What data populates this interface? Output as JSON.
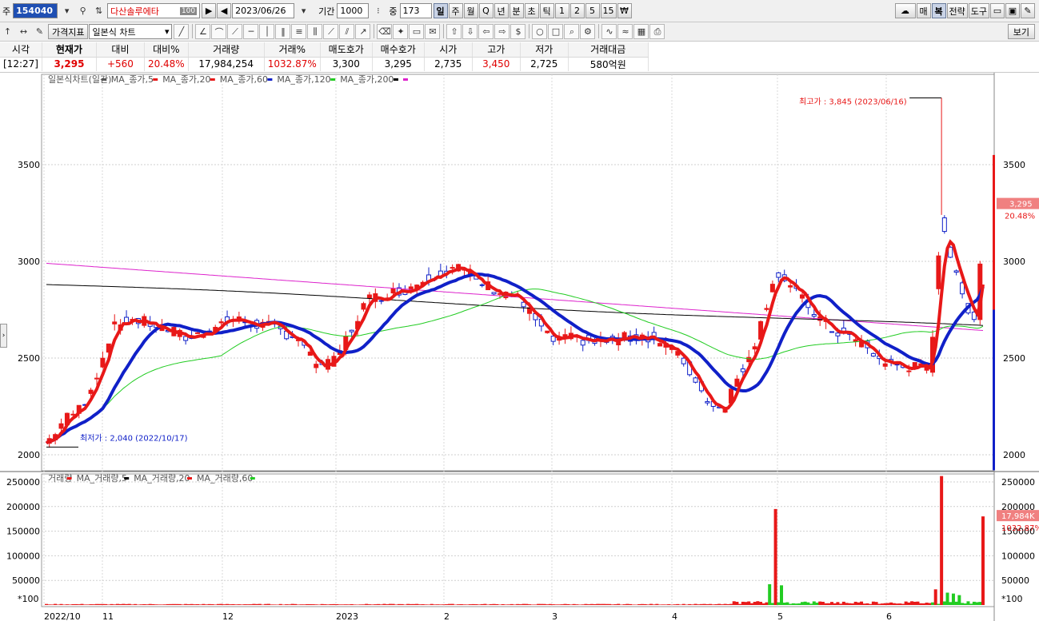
{
  "toolbar1": {
    "type_label": "주",
    "stock_code": "154040",
    "stock_name": "다산솔루에타",
    "name_badge": "100",
    "date": "2023/06/26",
    "period_label": "기간",
    "period_value": "1000",
    "count_label": "중",
    "count_value": "173",
    "intervals": [
      "일",
      "주",
      "월",
      "Q",
      "년",
      "분",
      "초",
      "틱",
      "1",
      "2",
      "5",
      "15"
    ],
    "active_interval": "일",
    "right_buttons": [
      "매",
      "복",
      "전략",
      "도구"
    ]
  },
  "toolbar2": {
    "price_indicator": "가격지표",
    "chart_type": "일본식 차트",
    "view_button": "보기"
  },
  "quote": {
    "headers": [
      "시각",
      "현재가",
      "대비",
      "대비%",
      "거래량",
      "거래%",
      "매도호가",
      "매수호가",
      "시가",
      "고가",
      "저가",
      "거래대금"
    ],
    "values": [
      "[12:27]",
      "3,295",
      "+560",
      "20.48%",
      "17,984,254",
      "1032.87%",
      "3,300",
      "3,295",
      "2,735",
      "3,450",
      "2,725",
      "580억원"
    ]
  },
  "price_panel": {
    "legend": [
      {
        "name": "일본식차트(일간)",
        "color": "#555555"
      },
      {
        "name": "MA_종가,5",
        "color": "#e81818"
      },
      {
        "name": "MA_종가,20",
        "color": "#e81818"
      },
      {
        "name": "MA_종가,60",
        "color": "#1020c8"
      },
      {
        "name": "MA_종가,120",
        "color": "#22cc22"
      },
      {
        "name": "MA_종가,200",
        "color": "#000000"
      },
      {
        "name": "",
        "color": "#dd22cc"
      }
    ],
    "y_ticks": [
      "3500",
      "3000",
      "2500",
      "2000"
    ],
    "high_annotation": "최고가 : 3,845 (2023/06/16)",
    "low_annotation": "최저가 : 2,040 (2022/10/17)",
    "current_price_label": "3,295",
    "current_change_label": "20.48%"
  },
  "volume_panel": {
    "legend": [
      {
        "name": "거래량",
        "color": "#e81818"
      },
      {
        "name": "MA_거래량,5",
        "color": "#000000"
      },
      {
        "name": "MA_거래량,20",
        "color": "#e81818"
      },
      {
        "name": "MA_거래량,60",
        "color": "#22cc22"
      }
    ],
    "y_ticks": [
      "250000",
      "200000",
      "150000",
      "100000",
      "50000"
    ],
    "scale_label": "*100",
    "current_volume_label": "17,984K",
    "current_ratio_label": "1032.87%"
  },
  "x_labels": [
    "2022/10",
    "11",
    "12",
    "2023",
    "2",
    "3",
    "4",
    "5",
    "6"
  ],
  "colors": {
    "up": "#e81818",
    "down": "#1020c8",
    "ma5": "#e81818",
    "ma20": "#1020c8",
    "ma60": "#22cc22",
    "ma120": "#000000",
    "ma200": "#dd22cc",
    "annotation_high": "#e81818",
    "annotation_low": "#1020c8"
  }
}
